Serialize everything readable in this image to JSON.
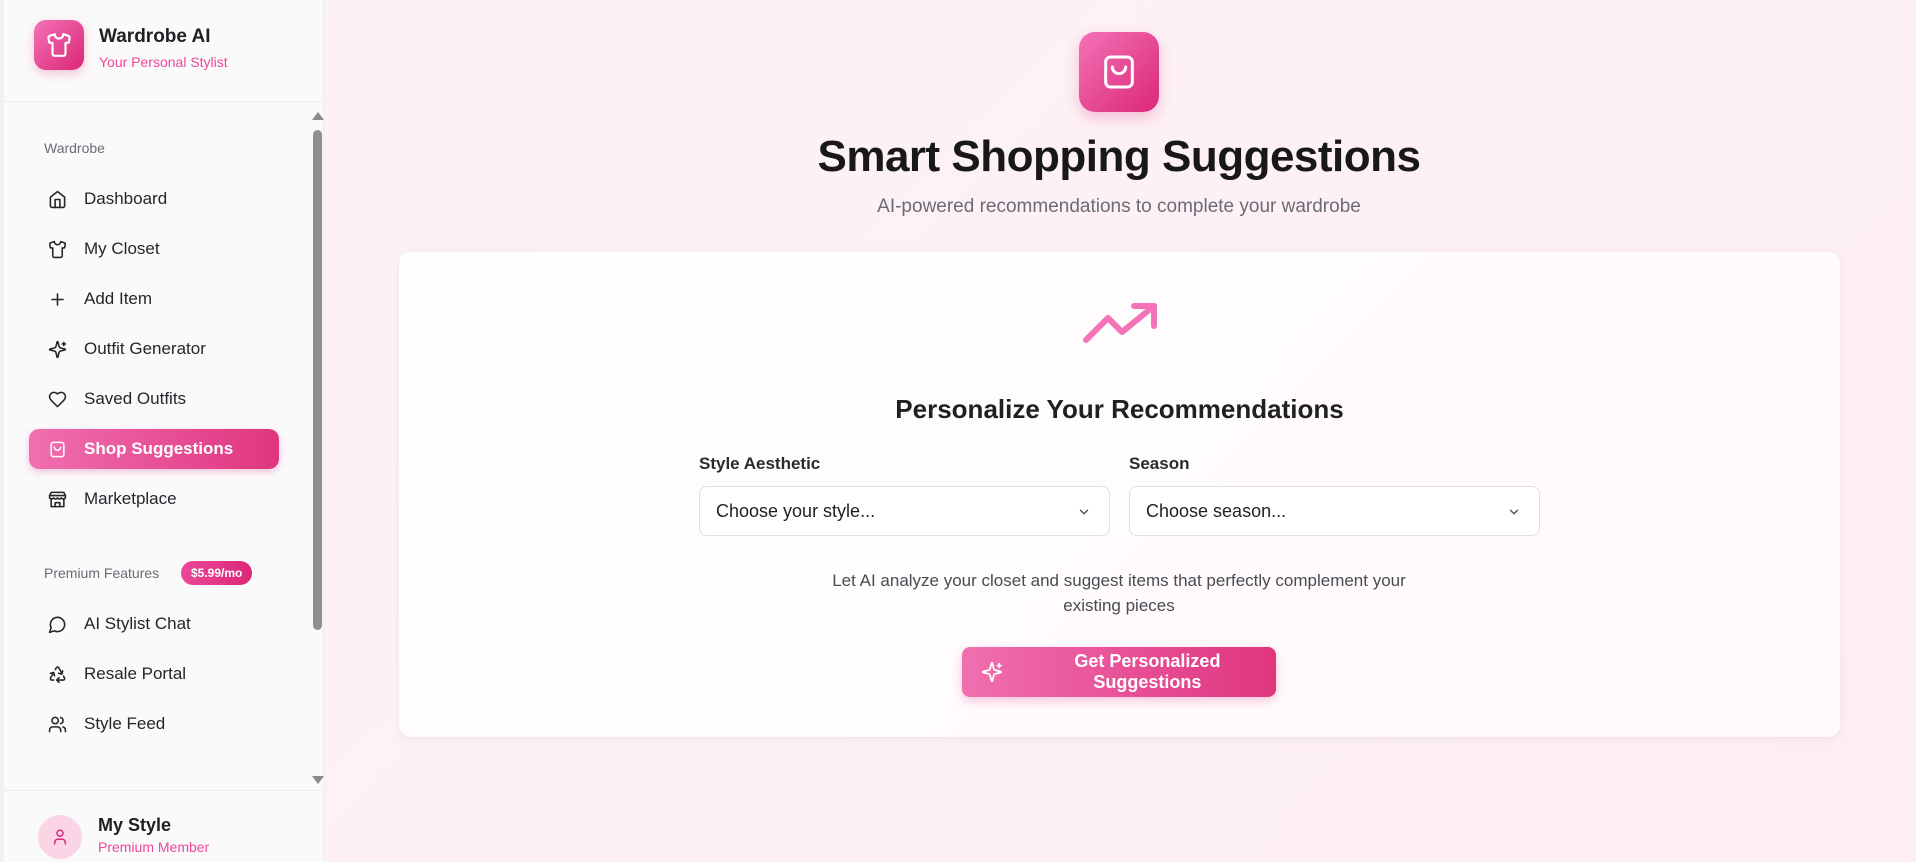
{
  "brand": {
    "title": "Wardrobe AI",
    "subtitle": "Your Personal Stylist",
    "logo_icon": "tshirt-icon"
  },
  "sidebar": {
    "sections": [
      {
        "label": "Wardrobe",
        "items": [
          {
            "label": "Dashboard",
            "icon": "home-icon",
            "active": false
          },
          {
            "label": "My Closet",
            "icon": "tshirt-icon",
            "active": false
          },
          {
            "label": "Add Item",
            "icon": "plus-icon",
            "active": false
          },
          {
            "label": "Outfit Generator",
            "icon": "sparkles-icon",
            "active": false
          },
          {
            "label": "Saved Outfits",
            "icon": "heart-icon",
            "active": false
          },
          {
            "label": "Shop Suggestions",
            "icon": "shopping-bag-icon",
            "active": true
          },
          {
            "label": "Marketplace",
            "icon": "store-icon",
            "active": false
          }
        ]
      },
      {
        "label": "Premium Features",
        "badge": "$5.99/mo",
        "items": [
          {
            "label": "AI Stylist Chat",
            "icon": "message-circle-icon",
            "active": false
          },
          {
            "label": "Resale Portal",
            "icon": "recycle-icon",
            "active": false
          },
          {
            "label": "Style Feed",
            "icon": "users-icon",
            "active": false
          }
        ]
      }
    ]
  },
  "user": {
    "name": "My Style",
    "role": "Premium Member",
    "avatar_icon": "user-icon"
  },
  "main": {
    "hero_icon": "shopping-bag-icon",
    "title": "Smart Shopping Suggestions",
    "subtitle": "AI-powered recommendations to complete your wardrobe",
    "card": {
      "icon": "trending-up-icon",
      "title": "Personalize Your Recommendations",
      "style_field": {
        "label": "Style Aesthetic",
        "value": "Choose your style..."
      },
      "season_field": {
        "label": "Season",
        "value": "Choose season..."
      },
      "helper_text": "Let AI analyze your closet and suggest items that perfectly complement your existing pieces",
      "cta_label": "Get Personalized Suggestions",
      "cta_icon": "sparkles-icon"
    }
  },
  "colors": {
    "accent": "#ec4899",
    "accent_dark": "#db2777",
    "background": "#fdf1f5"
  }
}
